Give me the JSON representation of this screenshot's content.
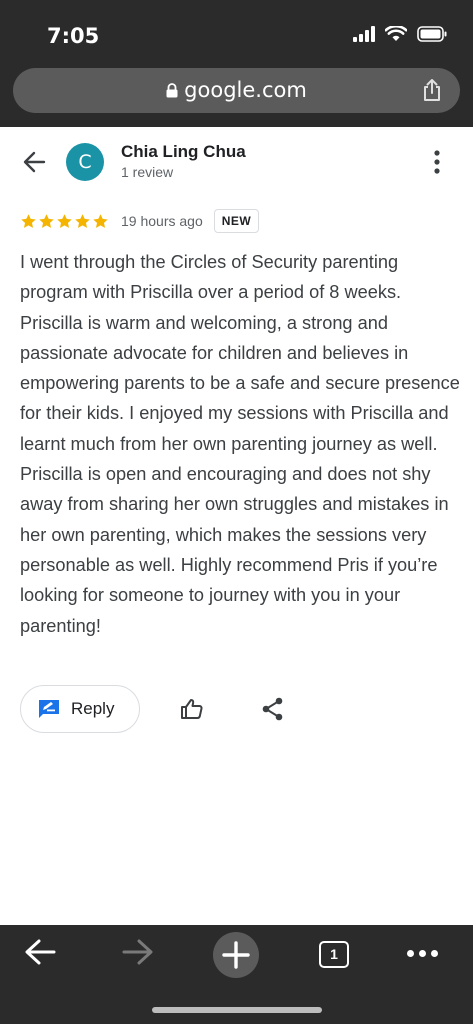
{
  "status_bar": {
    "time": "7:05"
  },
  "browser": {
    "url": "google.com",
    "tab_count": "1"
  },
  "reviewer": {
    "initial": "C",
    "name": "Chia Ling Chua",
    "review_count": "1 review",
    "avatar_color": "#1a93a6"
  },
  "review": {
    "rating": 5,
    "time_ago": "19 hours ago",
    "badge": "NEW",
    "text": "I went through the Circles of Security parenting program with Priscilla over a period of 8 weeks. Priscilla is warm and welcoming, a strong and passionate advocate for children and believes in empowering parents to be a safe and secure presence for their kids. I enjoyed my sessions with Priscilla and learnt much from her own parenting journey as well. Priscilla is open and encouraging and does not shy away from sharing her own struggles and mistakes in her own parenting, which makes the sessions very personable as well. Highly recommend Pris if you’re looking for someone to journey with you in your parenting!"
  },
  "actions": {
    "reply_label": "Reply"
  },
  "colors": {
    "star": "#f4b400",
    "reply_icon": "#1a73e8",
    "chrome_bar": "#2b2b2b"
  },
  "icons": [
    "lock-icon",
    "share-icon",
    "back-arrow-icon",
    "more-vert-icon",
    "star-icon",
    "reply-icon",
    "thumb-up-icon",
    "share-nodes-icon",
    "forward-arrow-icon",
    "plus-icon",
    "tabs-icon",
    "more-horiz-icon",
    "signal-icon",
    "wifi-icon",
    "battery-icon"
  ]
}
